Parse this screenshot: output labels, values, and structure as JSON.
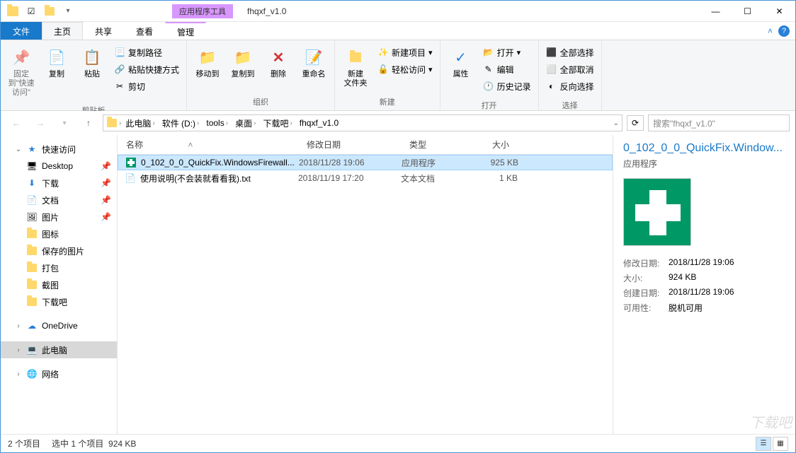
{
  "title": {
    "contextual_label": "应用程序工具",
    "folder": "fhqxf_v1.0"
  },
  "win": {
    "min": "—",
    "max": "☐",
    "close": "✕"
  },
  "tabs": {
    "file": "文件",
    "home": "主页",
    "share": "共享",
    "view": "查看",
    "manage": "管理"
  },
  "ribbon": {
    "pin": "固定到\"快速访问\"",
    "copy": "复制",
    "paste": "粘贴",
    "copy_path": "复制路径",
    "paste_shortcut": "粘贴快捷方式",
    "cut": "剪切",
    "clipboard_group": "剪贴板",
    "move_to": "移动到",
    "copy_to": "复制到",
    "delete": "删除",
    "rename": "重命名",
    "organize_group": "组织",
    "new_folder": "新建\n文件夹",
    "new_item": "新建项目",
    "easy_access": "轻松访问",
    "new_group": "新建",
    "properties": "属性",
    "open": "打开",
    "edit": "编辑",
    "history": "历史记录",
    "open_group": "打开",
    "select_all": "全部选择",
    "select_none": "全部取消",
    "invert": "反向选择",
    "select_group": "选择"
  },
  "breadcrumb": [
    "此电脑",
    "软件 (D:)",
    "tools",
    "桌面",
    "下载吧",
    "fhqxf_v1.0"
  ],
  "search_placeholder": "搜索\"fhqxf_v1.0\"",
  "sidebar": {
    "quick_access": "快速访问",
    "items": [
      "Desktop",
      "下载",
      "文档",
      "图片",
      "图标",
      "保存的图片",
      "打包",
      "截图",
      "下载吧"
    ],
    "onedrive": "OneDrive",
    "this_pc": "此电脑",
    "network": "网络"
  },
  "columns": {
    "name": "名称",
    "date": "修改日期",
    "type": "类型",
    "size": "大小"
  },
  "files": [
    {
      "name": "0_102_0_0_QuickFix.WindowsFirewall...",
      "date": "2018/11/28 19:06",
      "type": "应用程序",
      "size": "925 KB",
      "icon": "cross",
      "selected": true
    },
    {
      "name": "使用说明(不会装就看看我).txt",
      "date": "2018/11/19 17:20",
      "type": "文本文档",
      "size": "1 KB",
      "icon": "txt",
      "selected": false
    }
  ],
  "details": {
    "title": "0_102_0_0_QuickFix.Window...",
    "type": "应用程序",
    "meta": [
      {
        "label": "修改日期:",
        "value": "2018/11/28 19:06"
      },
      {
        "label": "大小:",
        "value": "924 KB"
      },
      {
        "label": "创建日期:",
        "value": "2018/11/28 19:06"
      },
      {
        "label": "可用性:",
        "value": "脱机可用"
      }
    ]
  },
  "status": {
    "count": "2 个项目",
    "selected": "选中 1 个项目",
    "size": "924 KB"
  },
  "watermark": "下载吧"
}
